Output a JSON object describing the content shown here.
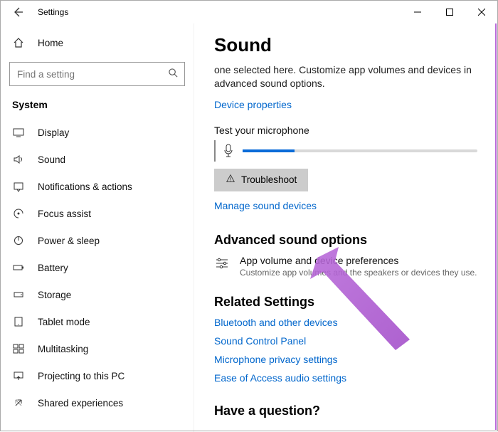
{
  "window": {
    "title": "Settings"
  },
  "sidebar": {
    "home_label": "Home",
    "search_placeholder": "Find a setting",
    "section_label": "System",
    "items": [
      {
        "label": "Display"
      },
      {
        "label": "Sound"
      },
      {
        "label": "Notifications & actions"
      },
      {
        "label": "Focus assist"
      },
      {
        "label": "Power & sleep"
      },
      {
        "label": "Battery"
      },
      {
        "label": "Storage"
      },
      {
        "label": "Tablet mode"
      },
      {
        "label": "Multitasking"
      },
      {
        "label": "Projecting to this PC"
      },
      {
        "label": "Shared experiences"
      }
    ]
  },
  "main": {
    "title": "Sound",
    "desc": "one selected here. Customize app volumes and devices in advanced sound options.",
    "device_properties_link": "Device properties",
    "test_label": "Test your microphone",
    "troubleshoot_label": "Troubleshoot",
    "manage_devices_link": "Manage sound devices",
    "advanced_heading": "Advanced sound options",
    "pref_title": "App volume and device preferences",
    "pref_sub": "Customize app volumes and the speakers or devices they use.",
    "related_heading": "Related Settings",
    "related_links": [
      "Bluetooth and other devices",
      "Sound Control Panel",
      "Microphone privacy settings",
      "Ease of Access audio settings"
    ],
    "question_heading": "Have a question?"
  }
}
